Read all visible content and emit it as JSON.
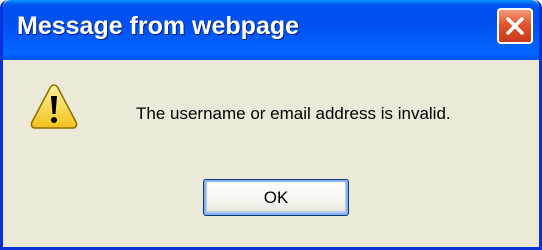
{
  "dialog": {
    "title": "Message from webpage",
    "message": "The username or email address is invalid.",
    "ok_label": "OK",
    "icon": "warning-icon",
    "close_icon": "close-icon"
  },
  "colors": {
    "titlebar": "#0053ee",
    "border": "#0831d9",
    "face": "#ece9d8",
    "close_button": "#e2552c",
    "warning_fill": "#f5d64a"
  }
}
